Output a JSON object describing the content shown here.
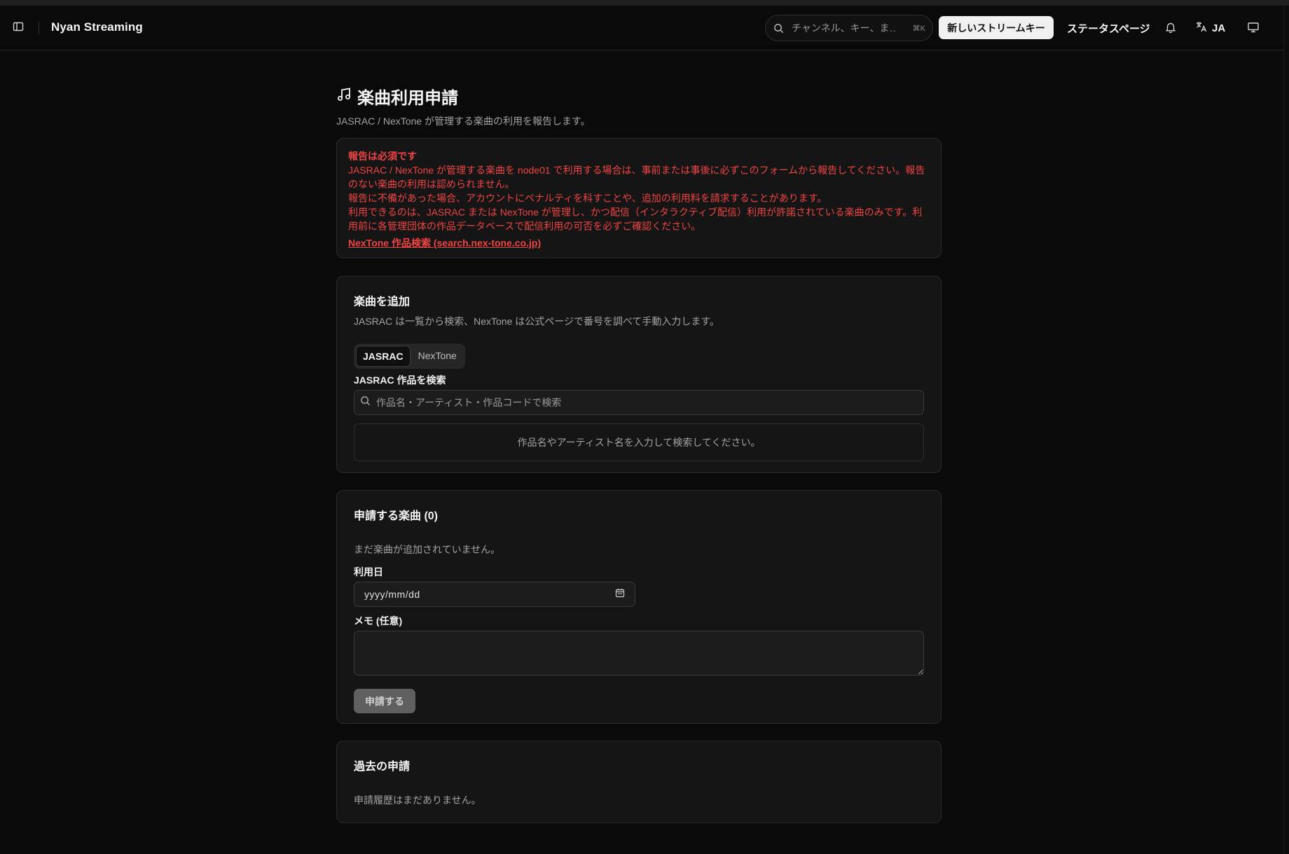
{
  "header": {
    "app_title": "Nyan Streaming",
    "search_placeholder": "チャンネル、キー、ま…",
    "search_shortcut": "⌘K",
    "new_key_label": "新しいストリームキー",
    "status_label": "ステータスページ",
    "language_code": "JA"
  },
  "page": {
    "title": "楽曲利用申請",
    "subtitle": "JASRAC / NexTone が管理する楽曲の利用を報告します。"
  },
  "alert": {
    "title": "報告は必須です",
    "line1": "JASRAC / NexTone が管理する楽曲を node01 で利用する場合は、事前または事後に必ずこのフォームから報告してください。報告のない楽曲の利用は認められません。",
    "line2": "報告に不備があった場合、アカウントにペナルティを科すことや、追加の利用料を請求することがあります。",
    "line3": "利用できるのは、JASRAC または NexTone が管理し、かつ配信（インタラクティブ配信）利用が許諾されている楽曲のみです。利用前に各管理団体の作品データベースで配信利用の可否を必ずご確認ください。",
    "link_label": "NexTone 作品検索 (search.nex-tone.co.jp)"
  },
  "add_song": {
    "title": "楽曲を追加",
    "description": "JASRAC は一覧から検索、NexTone は公式ページで番号を調べて手動入力します。",
    "tabs": [
      {
        "label": "JASRAC",
        "active": true
      },
      {
        "label": "NexTone",
        "active": false
      }
    ],
    "search_label": "JASRAC 作品を検索",
    "search_placeholder": "作品名・アーティスト・作品コードで検索",
    "empty_message": "作品名やアーティスト名を入力して検索してください。"
  },
  "application": {
    "title": "申請する楽曲 (0)",
    "empty_message": "まだ楽曲が追加されていません。",
    "date_label": "利用日",
    "date_placeholder": "yyyy/mm/dd",
    "memo_label": "メモ (任意)",
    "memo_value": "",
    "submit_label": "申請する"
  },
  "history": {
    "title": "過去の申請",
    "empty_message": "申請履歴はまだありません。"
  },
  "colors": {
    "background": "#0a0a0a",
    "card": "#151515",
    "alert_red": "#ef4444",
    "primary_button": "#f0f0f0",
    "disabled_button": "#5f5f5f"
  },
  "icons": [
    "sidebar-toggle-icon",
    "search-icon",
    "bell-icon",
    "translate-icon",
    "monitor-icon",
    "music-note-icon",
    "calendar-icon"
  ]
}
